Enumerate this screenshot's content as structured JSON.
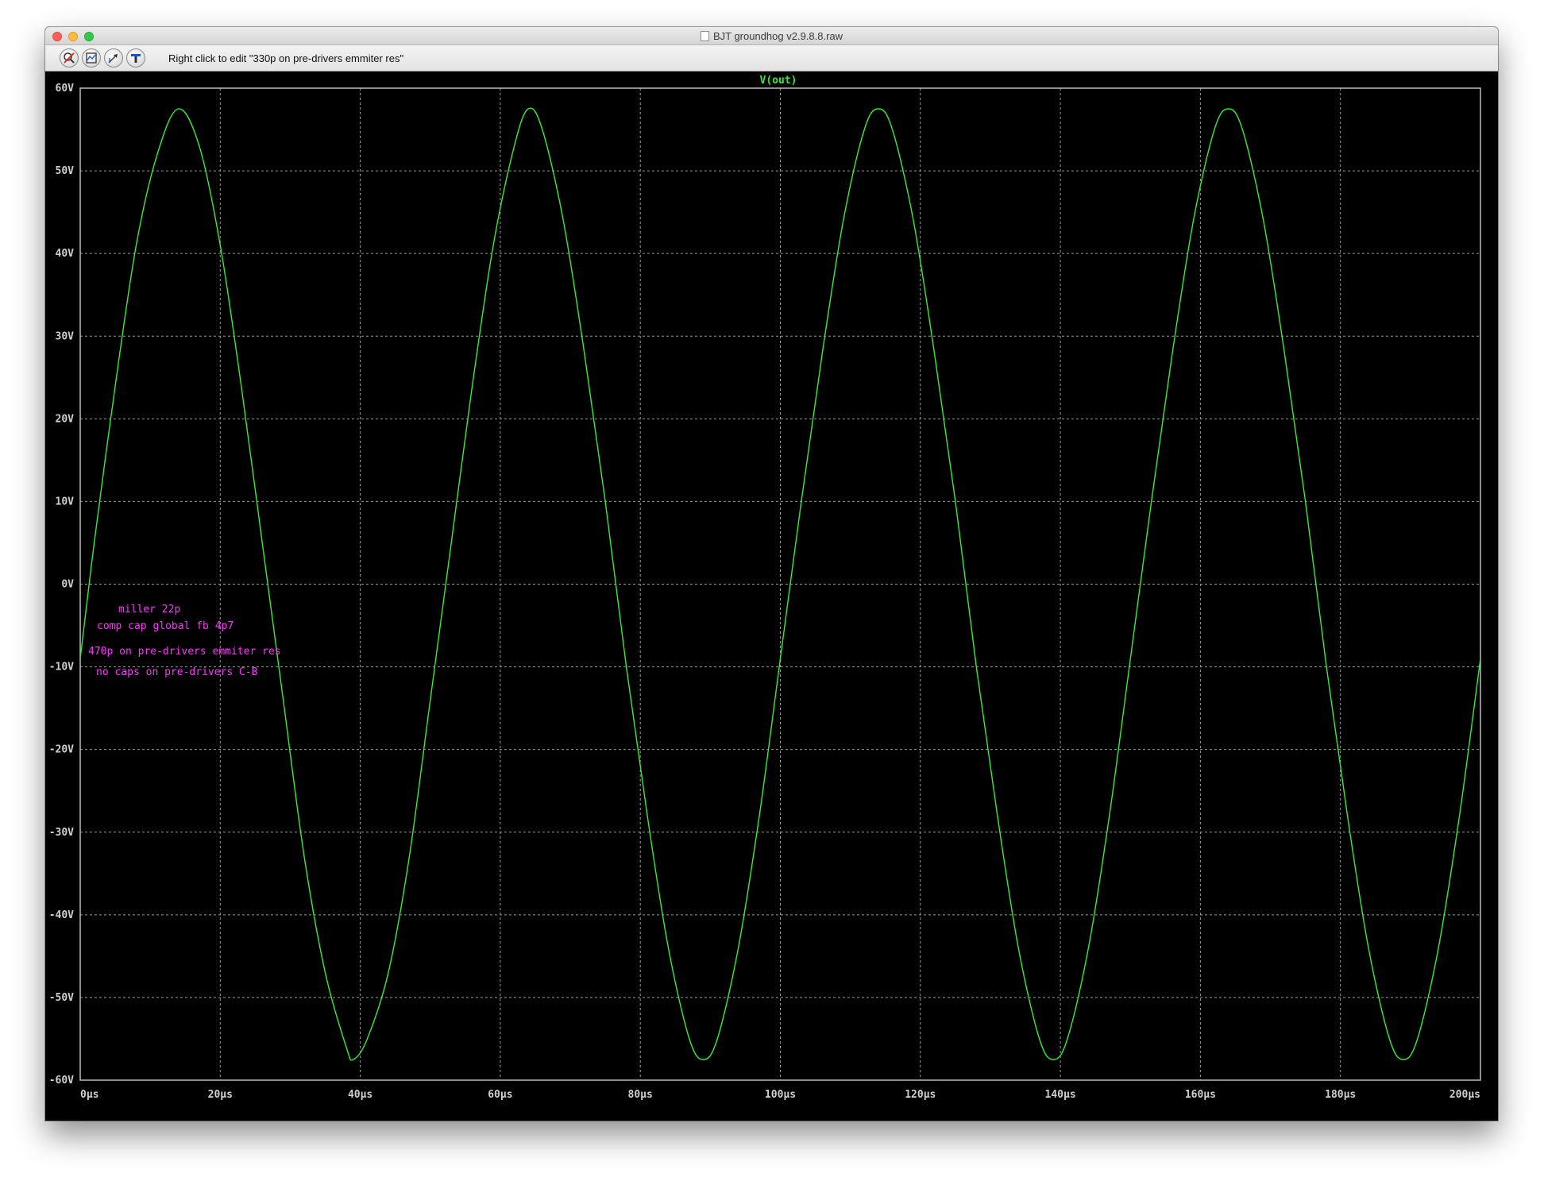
{
  "window": {
    "title": "BJT groundhog v2.9.8.8.raw"
  },
  "toolbar": {
    "hint": "Right click to edit \"330p on pre-drivers emmiter res\"",
    "buttons": [
      "zoom-cancel-icon",
      "autorange-icon",
      "pan-icon",
      "measure-icon"
    ]
  },
  "colors": {
    "background": "#000000",
    "trace": "#33ee33",
    "grid": "#9a9a9a",
    "annotation": "#ff33ff",
    "axis_text": "#d0d0d0"
  },
  "annotations": [
    "miller 22p",
    "comp cap global fb 4p7",
    "470p on pre-drivers emmiter res",
    "no caps on pre-drivers C-B"
  ],
  "chart_data": {
    "type": "line",
    "title": "V(out)",
    "xlabel": "",
    "ylabel": "",
    "xlim": [
      0,
      200
    ],
    "ylim": [
      -60,
      60
    ],
    "x_ticks": [
      "0µs",
      "20µs",
      "40µs",
      "60µs",
      "80µs",
      "100µs",
      "120µs",
      "140µs",
      "160µs",
      "180µs",
      "200µs"
    ],
    "y_ticks": [
      "60V",
      "50V",
      "40V",
      "30V",
      "20V",
      "10V",
      "0V",
      "-10V",
      "-20V",
      "-30V",
      "-40V",
      "-50V",
      "-60V"
    ],
    "grid": true,
    "series": [
      {
        "name": "V(out)",
        "x_unit": "µs",
        "y_unit": "V",
        "x": [
          0,
          2,
          5,
          8,
          11,
          14,
          17,
          20,
          23,
          26,
          29,
          32,
          35,
          38,
          39,
          41,
          44,
          47,
          50,
          53,
          56,
          59,
          62,
          64,
          66,
          69,
          72,
          75,
          78,
          81,
          84,
          87,
          89,
          91,
          94,
          97,
          100,
          103,
          106,
          109,
          112,
          114,
          116,
          119,
          122,
          125,
          128,
          131,
          134,
          137,
          139,
          141,
          144,
          147,
          150,
          153,
          156,
          159,
          162,
          164,
          166,
          169,
          172,
          175,
          178,
          181,
          184,
          187,
          189,
          191,
          194,
          197,
          200
        ],
        "y": [
          -9,
          5,
          24,
          41,
          52,
          57.5,
          53,
          41,
          24,
          5,
          -14,
          -33,
          -47,
          -56,
          -57.5,
          -55,
          -47,
          -33,
          -14,
          5,
          24,
          41,
          53,
          57.5,
          55,
          44,
          28,
          10,
          -10,
          -28,
          -44,
          -55,
          -57.5,
          -55,
          -44,
          -28,
          -9,
          10,
          28,
          44,
          55,
          57.5,
          55,
          44,
          28,
          10,
          -10,
          -28,
          -44,
          -55,
          -57.5,
          -55,
          -44,
          -28,
          -9,
          10,
          28,
          44,
          55,
          57.5,
          55,
          44,
          28,
          10,
          -10,
          -28,
          -44,
          -55,
          -57.5,
          -55,
          -44,
          -28,
          -9
        ]
      }
    ]
  }
}
